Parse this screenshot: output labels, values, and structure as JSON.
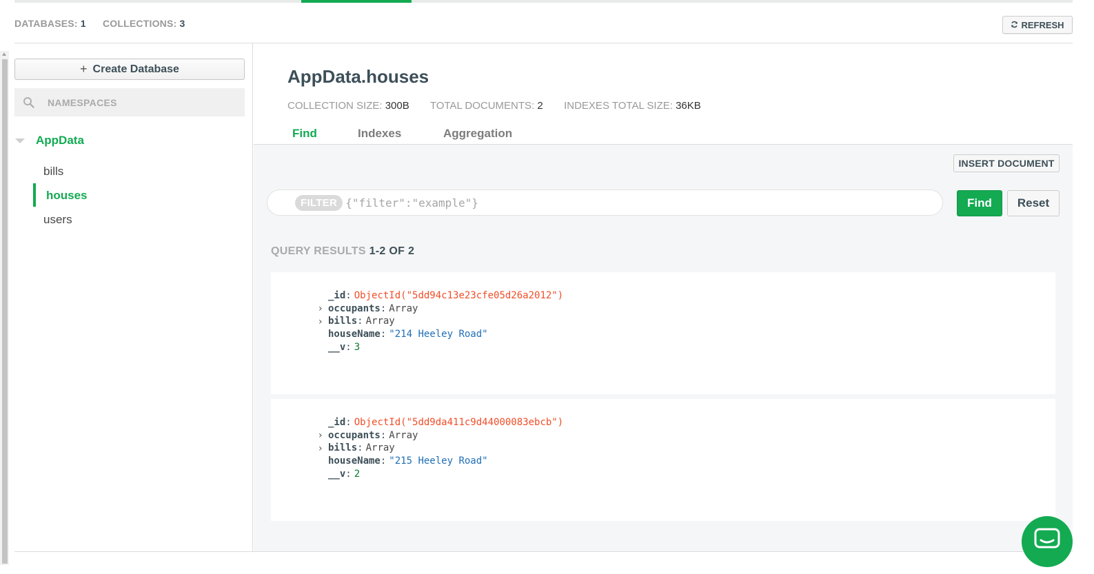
{
  "stats": {
    "databases_label": "DATABASES:",
    "databases_count": "1",
    "collections_label": "COLLECTIONS:",
    "collections_count": "3",
    "refresh_label": "REFRESH"
  },
  "sidebar": {
    "create_db_label": "Create Database",
    "search_placeholder": "NAMESPACES",
    "database": "AppData",
    "collections": [
      "bills",
      "houses",
      "users"
    ],
    "active_collection": "houses"
  },
  "collection": {
    "title": "AppData.houses",
    "size_label": "COLLECTION SIZE:",
    "size_value": "300B",
    "docs_label": "TOTAL DOCUMENTS:",
    "docs_value": "2",
    "idx_label": "INDEXES TOTAL SIZE:",
    "idx_value": "36KB"
  },
  "tabs": [
    "Find",
    "Indexes",
    "Aggregation"
  ],
  "actions": {
    "insert_label": "INSERT DOCUMENT",
    "filter_pill": "FILTER",
    "filter_placeholder": "{\"filter\":\"example\"}",
    "find_label": "Find",
    "reset_label": "Reset"
  },
  "results": {
    "label": "QUERY RESULTS",
    "range": "1-2 OF 2"
  },
  "documents": [
    {
      "id_key": "_id",
      "id_value": "ObjectId(\"5dd94c13e23cfe05d26a2012\")",
      "occupants_key": "occupants",
      "occupants_value": "Array",
      "bills_key": "bills",
      "bills_value": "Array",
      "house_key": "houseName",
      "house_value": "\"214 Heeley Road\"",
      "v_key": "__v",
      "v_value": "3"
    },
    {
      "id_key": "_id",
      "id_value": "ObjectId(\"5dd9da411c9d44000083ebcb\")",
      "occupants_key": "occupants",
      "occupants_value": "Array",
      "bills_key": "bills",
      "bills_value": "Array",
      "house_key": "houseName",
      "house_value": "\"215 Heeley Road\"",
      "v_key": "__v",
      "v_value": "2"
    }
  ],
  "colors": {
    "accent": "#13aa52",
    "object_id": "#f04d28",
    "string": "#1e6eb6",
    "number": "#0d7a2e"
  },
  "icons": [
    "refresh-icon",
    "plus-icon",
    "search-icon",
    "caret-down-icon",
    "chevron-right-icon",
    "chat-icon"
  ]
}
